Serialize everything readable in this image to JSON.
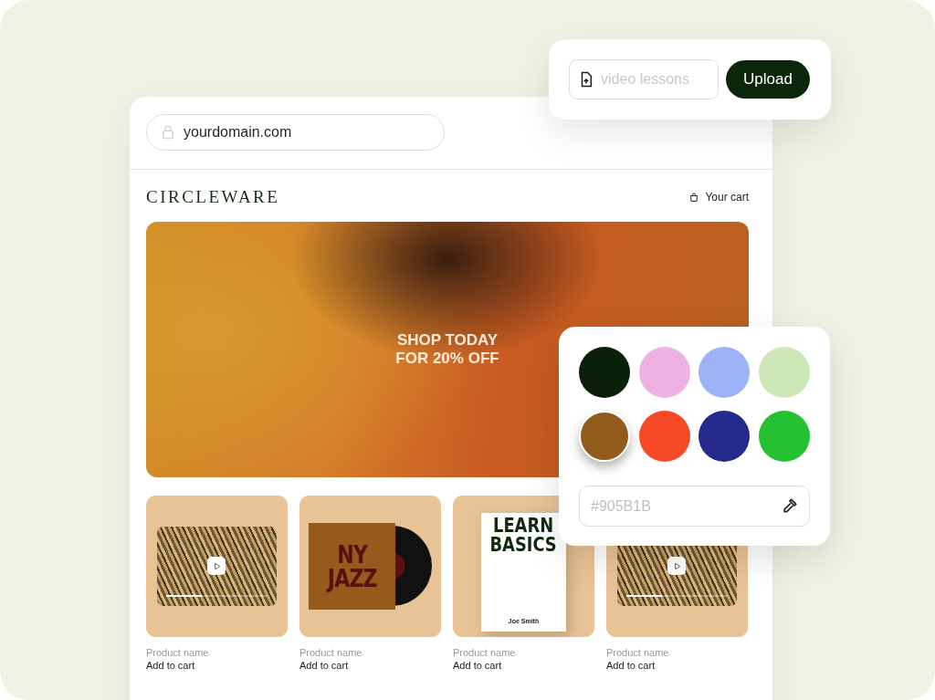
{
  "upload": {
    "placeholder": "video lessons",
    "button": "Upload"
  },
  "browser": {
    "url": "yourdomain.com"
  },
  "store": {
    "logo": "CIRCLEWARE",
    "cart": "Your cart",
    "hero_lines": [
      "SHOP TODAY",
      "FOR 20% OFF"
    ],
    "products": [
      {
        "kind": "video",
        "level": 0.35,
        "name": "Product name",
        "action": "Add to cart"
      },
      {
        "kind": "record",
        "cover_lines": [
          "NY",
          "JAZZ"
        ],
        "name": "Product name",
        "action": "Add to cart"
      },
      {
        "kind": "book",
        "title_lines": [
          "LEARN",
          "BASICS"
        ],
        "author": "Joe Smith",
        "name": "Product name",
        "action": "Add to cart"
      },
      {
        "kind": "video",
        "level": 0.35,
        "name": "Product name",
        "action": "Add to cart"
      }
    ]
  },
  "palette": {
    "swatches": [
      {
        "color": "#0b2008",
        "selected": false
      },
      {
        "color": "#eeb2e4",
        "selected": false
      },
      {
        "color": "#9db3f8",
        "selected": false
      },
      {
        "color": "#cde7b6",
        "selected": false
      },
      {
        "color": "#905b1b",
        "selected": true
      },
      {
        "color": "#f54a25",
        "selected": false
      },
      {
        "color": "#232a8c",
        "selected": false
      },
      {
        "color": "#26c033",
        "selected": false
      }
    ],
    "hex": "#905B1B"
  }
}
